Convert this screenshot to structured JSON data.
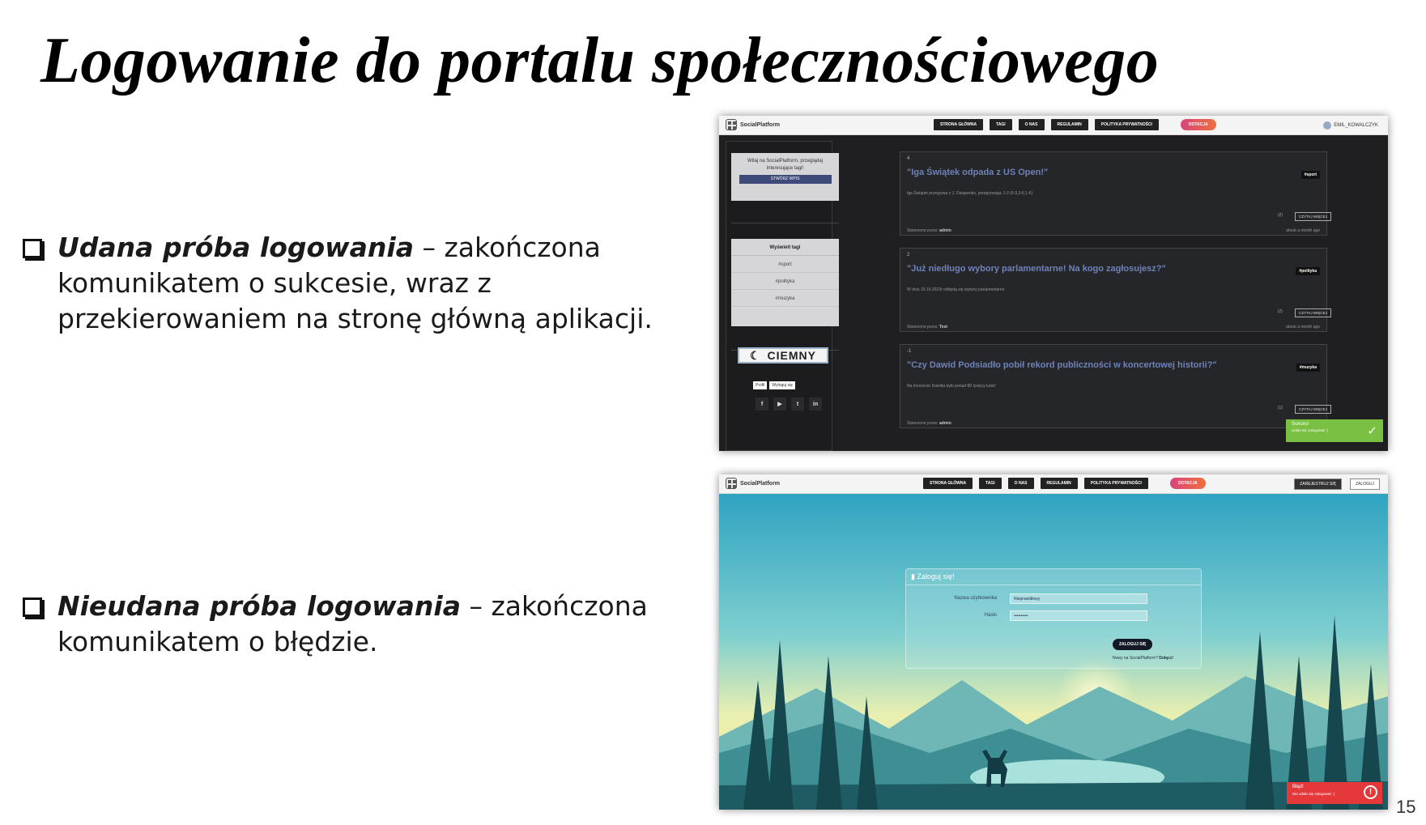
{
  "slide": {
    "title": "Logowanie do portalu społecznościowego",
    "page_number": "15",
    "bullets": [
      {
        "bold": "Udana próba logowania",
        "rest": " – zakończona komunikatem o sukcesie, wraz z przekierowaniem na stronę główną aplikacji."
      },
      {
        "bold": "Nieudana próba logowania",
        "rest": " – zakończona komunikatem o błędzie."
      }
    ]
  },
  "app": {
    "brand": "SocialPlatform",
    "nav": [
      "STRONA GŁÓWNA",
      "TAGI",
      "O NAS",
      "REGULAMIN",
      "POLITYKA PRYWATNOŚCI"
    ],
    "donate": "DOTACJA",
    "user": "EMIL_KOWALCZYK",
    "register": "ZAREJESTRUJ SIĘ",
    "login": "ZALOGUJ"
  },
  "home": {
    "welcome_line1": "Witaj na SocialPlatform, przeglądaj",
    "welcome_line2": "interesujące tagi!",
    "create_post": "STWÓRZ WPIS",
    "show_tags": "Wyświetl tagi",
    "tags": [
      "#sport",
      "#polityka",
      "#muzyka"
    ],
    "theme_button": "CIEMNY",
    "profile_link": "Profil",
    "logout_link": "Wyloguj się",
    "socials": [
      "f",
      "▶",
      "t",
      "in"
    ],
    "posts": [
      {
        "votes": "4",
        "title": "\"Iga Świątek odpada z US Open!\"",
        "tag": "#sport",
        "desc": "Iga Świątek przegrywa z J. Ostapenko, przegrywając 1-2 (6-3,3-6,1-6)",
        "comments": "(2)",
        "more": "CZYTAJ WIĘCEJ",
        "by_label": "Stworzone przez:",
        "by": "admin",
        "when": "about a month ago"
      },
      {
        "votes": "2",
        "title": "\"Już niedługo wybory parlamentarne! Na kogo zagłosujesz?\"",
        "tag": "#polityka",
        "desc": "W dniu 15.10.2023r odbędą się wybory parlamentarne",
        "comments": "(2)",
        "more": "CZYTAJ WIĘCEJ",
        "by_label": "Stworzone przez:",
        "by": "Test",
        "when": "about a month ago"
      },
      {
        "votes": "-1",
        "title": "\"Czy Dawid Podsiadło pobił rekord publiczności w koncertowej historii?\"",
        "tag": "#muzyka",
        "desc": "Na koncercie Dawida było ponad 80 tysięcy ludzi!",
        "comments": "(1)",
        "more": "CZYTAJ WIĘCEJ",
        "by_label": "Stworzone przez:",
        "by": "admin",
        "when": "about"
      }
    ],
    "toast_title": "Sukces!",
    "toast_text": "Udało się zalogować :)"
  },
  "login_page": {
    "heading": "Zaloguj się!",
    "username_label": "Nazwa użytkownika",
    "username_value": "Nieprawidłowy",
    "password_label": "Hasło",
    "password_value": "••••••••••",
    "submit": "ZALOGUJ SIĘ",
    "register_prompt": "Nowy na SocialPlatform?",
    "register_link": "Dołącz!",
    "toast_title": "Błąd!",
    "toast_text": "Nie udało się zalogować :("
  }
}
